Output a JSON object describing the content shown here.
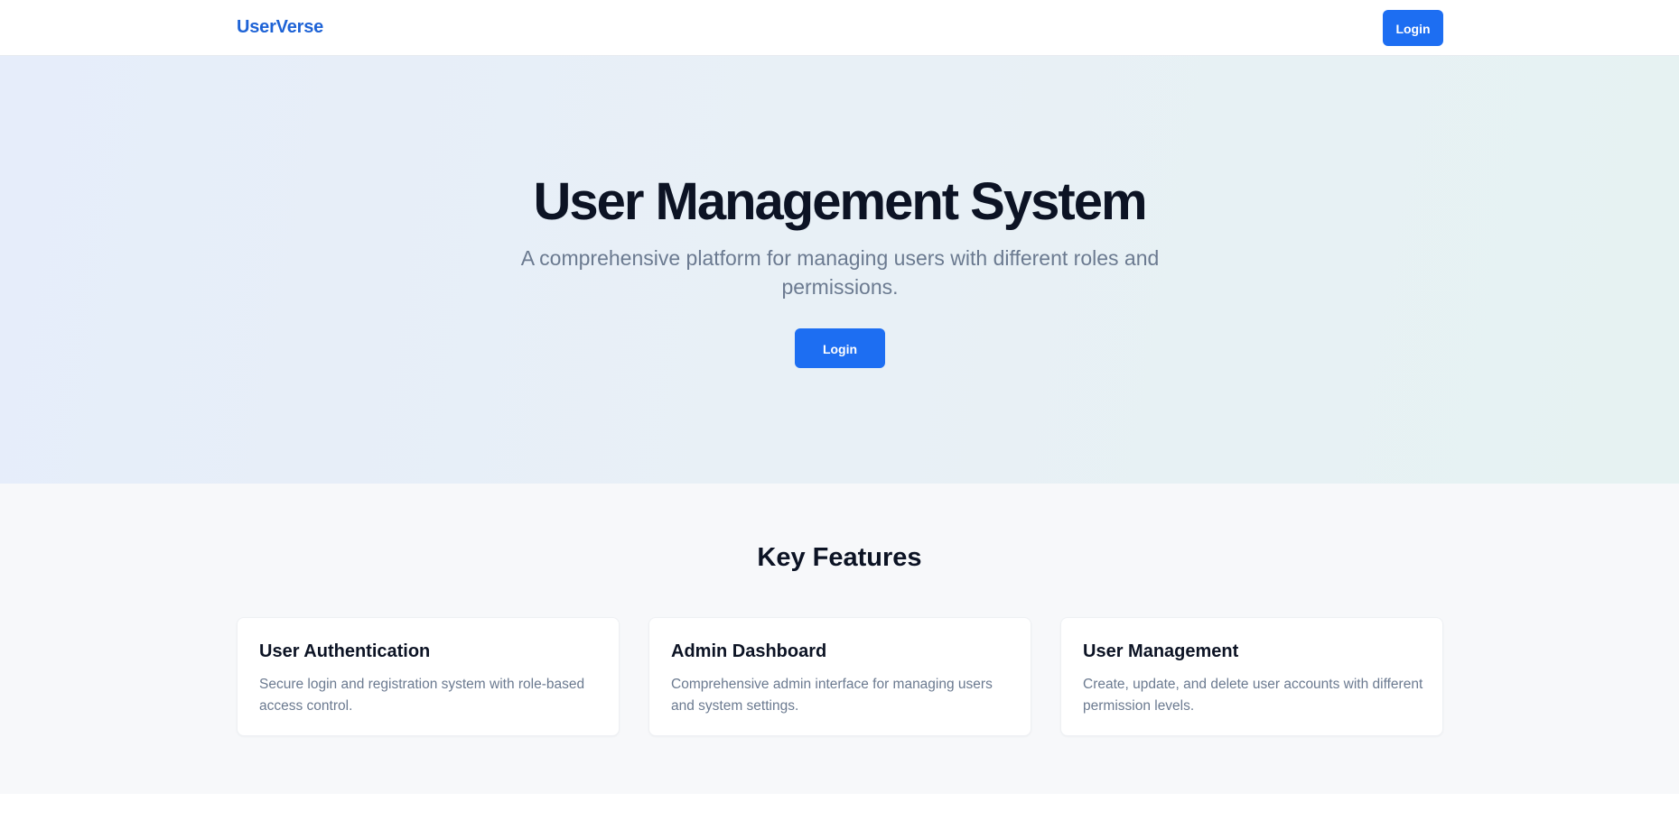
{
  "navbar": {
    "brand": "UserVerse",
    "login_label": "Login"
  },
  "hero": {
    "title": "User Management System",
    "subtitle": "A comprehensive platform for managing users with different roles and permissions.",
    "login_label": "Login"
  },
  "features": {
    "title": "Key Features",
    "cards": [
      {
        "title": "User Authentication",
        "text": "Secure login and registration system with role-based access control."
      },
      {
        "title": "Admin Dashboard",
        "text": "Comprehensive admin interface for managing users and system settings."
      },
      {
        "title": "User Management",
        "text": "Create, update, and delete user accounts with different permission levels."
      }
    ]
  },
  "colors": {
    "brand": "#1e63d6",
    "primary_button": "#1d6ef2",
    "heading": "#0c1324",
    "muted_text": "#6b7a90"
  }
}
